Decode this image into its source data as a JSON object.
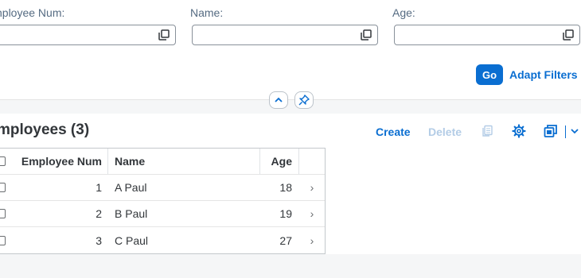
{
  "filters": [
    {
      "label": "nployee Num:",
      "value": "",
      "placeholder": ""
    },
    {
      "label": "Name:",
      "value": "",
      "placeholder": ""
    },
    {
      "label": "Age:",
      "value": "",
      "placeholder": ""
    }
  ],
  "filter_actions": {
    "go_label": "Go",
    "adapt_label": "Adapt Filters"
  },
  "icons": {
    "collapse": "chevron-up-icon",
    "pin": "pin-icon",
    "value_help": "value-help-icon",
    "copy": "copy-icon",
    "settings": "gear-icon",
    "export": "export-icon",
    "export_menu": "chevron-down-icon",
    "row_nav": "chevron-right-icon"
  },
  "colors": {
    "accent": "#0a6ed1",
    "disabled": "#b3cce6",
    "background": "#f5f6f7",
    "text": "#32363a"
  },
  "table": {
    "title": "mployees (3)",
    "toolbar": {
      "create_label": "Create",
      "delete_label": "Delete"
    },
    "columns": [
      "Employee Num",
      "Name",
      "Age"
    ],
    "nav_glyph": "›",
    "rows": [
      {
        "num": "1",
        "name": "A Paul",
        "age": "18"
      },
      {
        "num": "2",
        "name": "B Paul",
        "age": "19"
      },
      {
        "num": "3",
        "name": "C Paul",
        "age": "27"
      }
    ]
  }
}
